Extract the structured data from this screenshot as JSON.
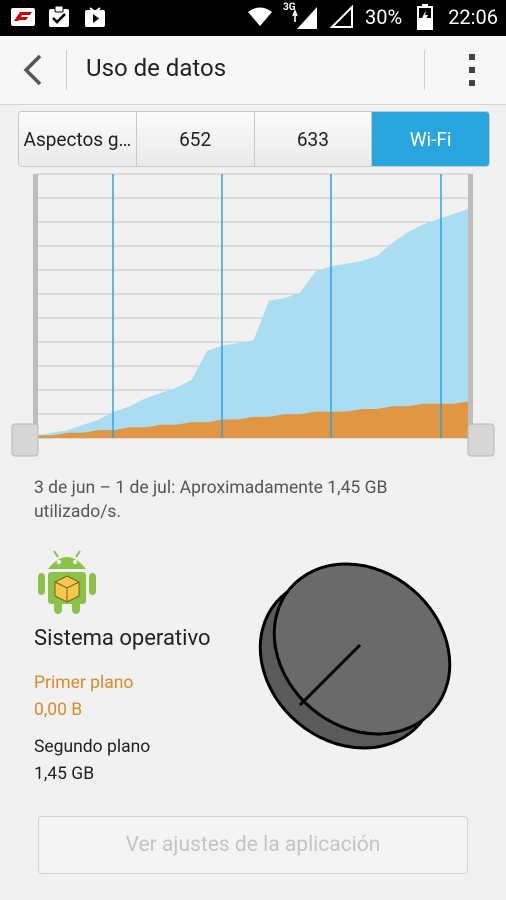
{
  "status_bar": {
    "network_label": "3G",
    "battery": "30%",
    "time": "22:06",
    "icons": [
      "f1-app-icon",
      "check-icon",
      "play-store-icon",
      "wifi-icon",
      "signal-icon",
      "signal-empty-icon",
      "battery-icon"
    ]
  },
  "app_bar": {
    "title": "Uso de datos",
    "icons": [
      "back-arrow-icon",
      "overflow-menu-icon"
    ]
  },
  "tabs": [
    {
      "label": "Aspectos g…",
      "active": false
    },
    {
      "label": "652",
      "active": false
    },
    {
      "label": "633",
      "active": false
    },
    {
      "label": "Wi-Fi",
      "active": true
    }
  ],
  "chart_data": {
    "type": "area",
    "x_range": [
      "3 de jun",
      "1 de jul"
    ],
    "series": [
      {
        "color": "#aadcf2",
        "values": [
          0.01,
          0.02,
          0.03,
          0.05,
          0.07,
          0.1,
          0.12,
          0.15,
          0.17,
          0.19,
          0.22,
          0.33,
          0.35,
          0.36,
          0.37,
          0.52,
          0.53,
          0.55,
          0.63,
          0.65,
          0.66,
          0.67,
          0.69,
          0.74,
          0.78,
          0.81,
          0.83,
          0.85,
          0.87
        ]
      },
      {
        "color": "#e58e2f",
        "values": [
          0.01,
          0.01,
          0.02,
          0.02,
          0.03,
          0.03,
          0.04,
          0.04,
          0.05,
          0.05,
          0.06,
          0.06,
          0.07,
          0.07,
          0.08,
          0.08,
          0.09,
          0.09,
          0.1,
          0.1,
          0.1,
          0.11,
          0.11,
          0.12,
          0.12,
          0.13,
          0.13,
          0.13,
          0.14
        ]
      }
    ],
    "ylim": [
      0,
      1
    ],
    "grid": true,
    "gridline_color": "#2aa6df"
  },
  "summary": "3 de jun – 1 de jul: Aproximadamente 1,45 GB utilizado/s.",
  "app": {
    "name": "Sistema operativo",
    "icon": "android-package-icon",
    "foreground_label": "Primer plano",
    "foreground_value": "0,00 B",
    "background_label": "Segundo plano",
    "background_value": "1,45 GB",
    "pie_color": "#6a6a6a",
    "foreground_color": "#d98a2a"
  },
  "settings_button": "Ver ajustes de la aplicación"
}
